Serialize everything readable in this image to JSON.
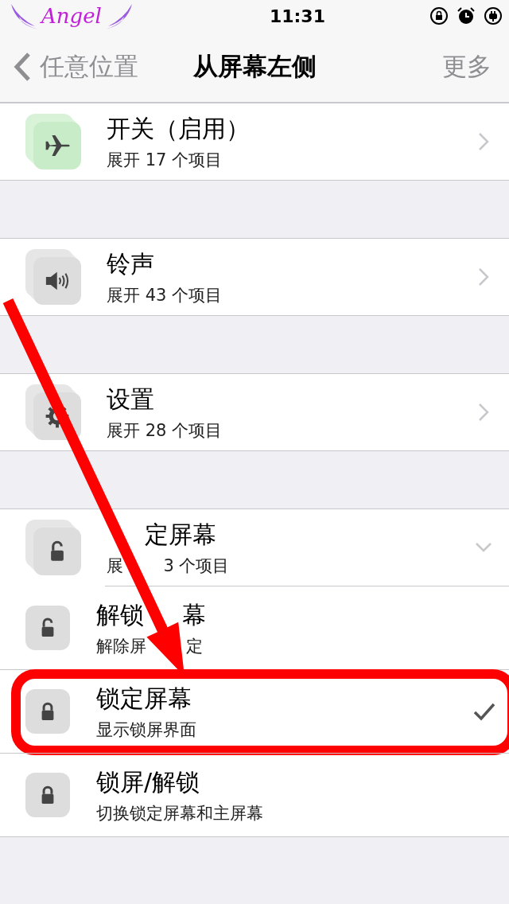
{
  "status_bar": {
    "carrier": "Angel",
    "time": "11:31"
  },
  "nav": {
    "back": "任意位置",
    "title": "从屏幕左侧",
    "action": "更多"
  },
  "groups": [
    {
      "title": "开关（启用）",
      "subtitle": "展开 17 个项目",
      "kind": "airplane",
      "expanded": false
    },
    {
      "title": "铃声",
      "subtitle": "展开 43 个项目",
      "kind": "speaker",
      "expanded": false
    },
    {
      "title": "设置",
      "subtitle": "展开 28 个项目",
      "kind": "gear",
      "expanded": false
    },
    {
      "title": [
        {
          "text": "定屏幕",
          "gap_before": true
        }
      ],
      "subtitle": [
        {
          "text": "展",
          "gap_before": false
        },
        {
          "text": "3 个项目",
          "gap_before": true
        }
      ],
      "kind": "unlock",
      "expanded": true,
      "children": [
        {
          "title": [
            {
              "text": "解锁",
              "gap_before": false
            },
            {
              "text": "幕",
              "gap_before": true
            }
          ],
          "subtitle": [
            {
              "text": "解除屏",
              "gap_before": false
            },
            {
              "text": "定",
              "gap_before": true
            }
          ],
          "kind": "unlock",
          "selected": false
        },
        {
          "title": "锁定屏幕",
          "subtitle": "显示锁屏界面",
          "kind": "lock",
          "selected": true
        },
        {
          "title": "锁屏/解锁",
          "subtitle": "切换锁定屏幕和主屏幕",
          "kind": "lock",
          "selected": false
        }
      ]
    }
  ]
}
